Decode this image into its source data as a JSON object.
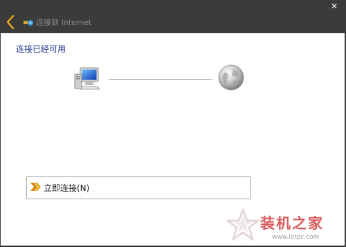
{
  "window": {
    "title": "连接到 Internet",
    "close_glyph": "✕",
    "back_icon": "back-arrow-icon",
    "title_icon": "network-connection-icon"
  },
  "content": {
    "heading": "连接已经可用",
    "computer_icon": "computer-icon",
    "globe_icon": "internet-globe-icon"
  },
  "option": {
    "label": "立即连接(N)",
    "icon": "double-chevron-right-icon"
  },
  "watermark": {
    "name": "装机之家",
    "url": "www.lotpc.com"
  },
  "colors": {
    "titlebar": "#3b3b3b",
    "heading": "#1e3287",
    "back_arrow": "#f0b21a",
    "option_arrow": "#d08a10",
    "watermark": "#d64a4a"
  }
}
